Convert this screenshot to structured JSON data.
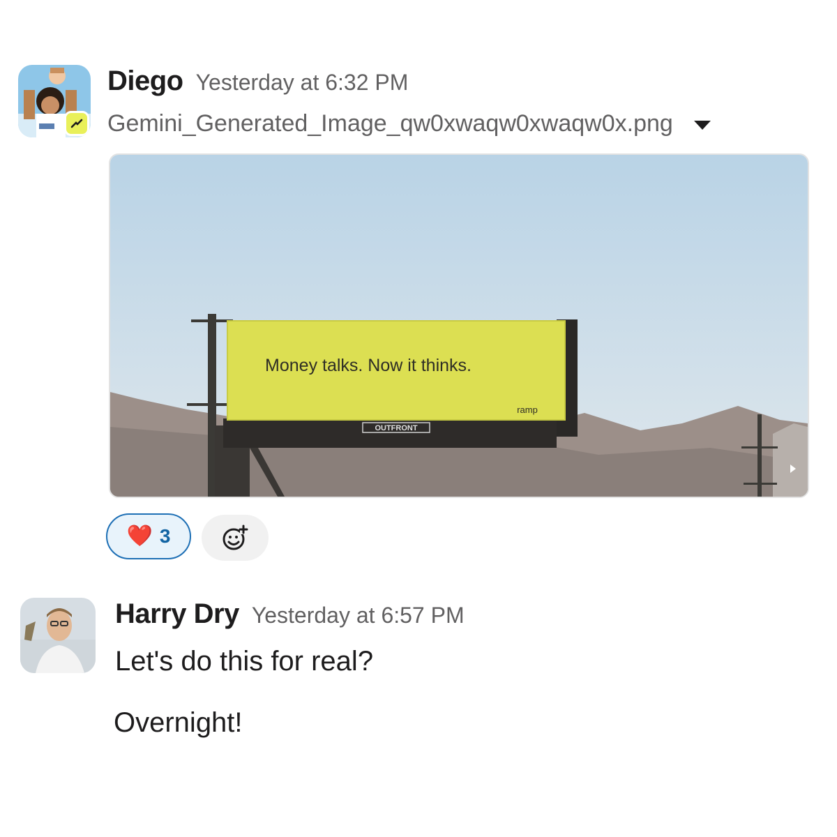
{
  "messages": [
    {
      "author": "Diego",
      "timestamp": "Yesterday at 6:32 PM",
      "avatar_icon": "diego-pixel-avatar",
      "status_badge_icon": "yellow-ramp-badge-icon",
      "attachment": {
        "filename": "Gemini_Generated_Image_qw0xwaqw0xwaqw0x.png",
        "caret_icon": "chevron-down-icon",
        "image": {
          "billboard_text": "Money talks. Now it thinks.",
          "brand_text": "ramp",
          "operator_text": "OUTFRONT",
          "billboard_color": "#dcdf52"
        }
      },
      "reactions": [
        {
          "emoji": "❤️",
          "count": "3"
        }
      ],
      "add_reaction_icon": "add-emoji-icon"
    },
    {
      "author": "Harry Dry",
      "timestamp": "Yesterday at 6:57 PM",
      "avatar_icon": "harry-photo-avatar",
      "lines": [
        "Let's do this for real?",
        "Overnight!"
      ]
    }
  ],
  "colors": {
    "reaction_border": "#1d6fb5",
    "reaction_bg": "#e8f3fb",
    "muted_text": "#616061"
  }
}
